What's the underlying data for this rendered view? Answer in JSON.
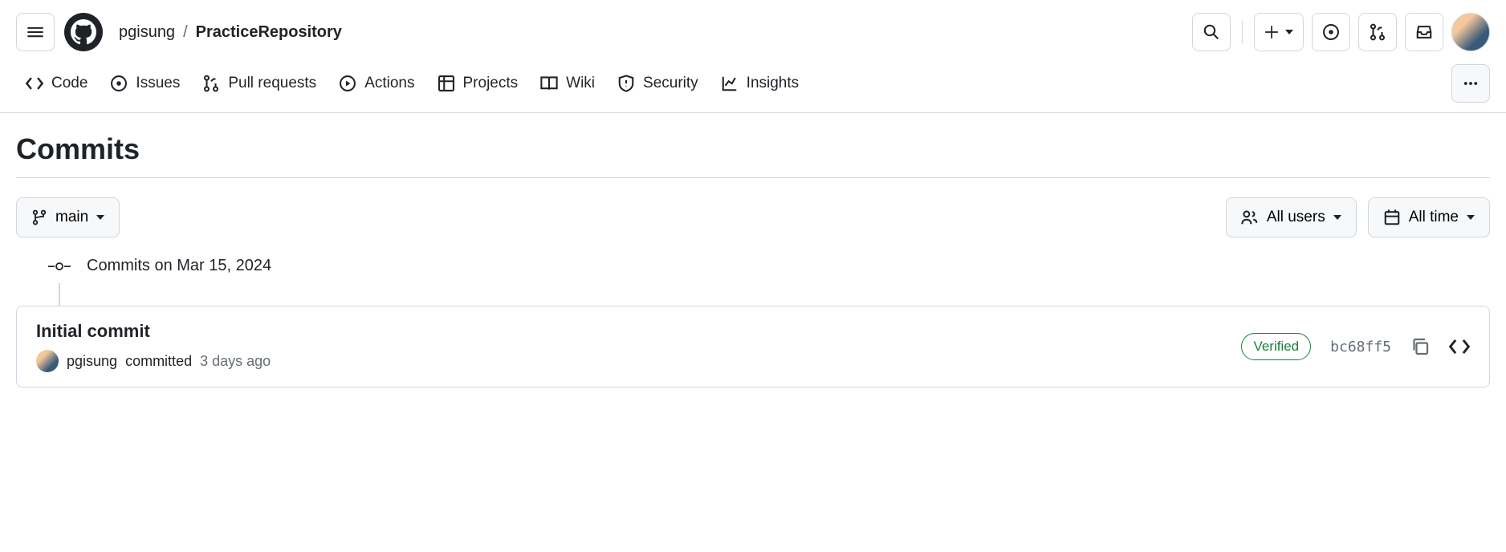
{
  "header": {
    "owner": "pgisung",
    "separator": "/",
    "repo": "PracticeRepository"
  },
  "tabs": [
    {
      "label": "Code",
      "icon": "code-icon"
    },
    {
      "label": "Issues",
      "icon": "issue-icon"
    },
    {
      "label": "Pull requests",
      "icon": "pull-request-icon"
    },
    {
      "label": "Actions",
      "icon": "play-icon"
    },
    {
      "label": "Projects",
      "icon": "table-icon"
    },
    {
      "label": "Wiki",
      "icon": "book-icon"
    },
    {
      "label": "Security",
      "icon": "shield-icon"
    },
    {
      "label": "Insights",
      "icon": "graph-icon"
    }
  ],
  "page": {
    "title": "Commits"
  },
  "filters": {
    "branch": "main",
    "users": "All users",
    "time": "All time"
  },
  "timeline": {
    "date_label": "Commits on Mar 15, 2024"
  },
  "commit": {
    "title": "Initial commit",
    "author": "pgisung",
    "action": "committed",
    "time": "3 days ago",
    "verified_label": "Verified",
    "sha": "bc68ff5"
  }
}
